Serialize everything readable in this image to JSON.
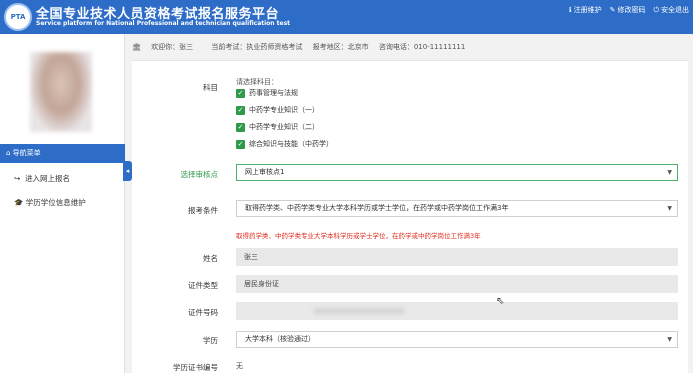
{
  "header": {
    "logo_text": "PTA",
    "title_cn": "全国专业技术人员资格考试报名服务平台",
    "title_en": "Service platform for National Professional and technician qualification test",
    "links": [
      {
        "icon": "info-icon",
        "glyph": "ℹ",
        "label": "注册维护"
      },
      {
        "icon": "edit-icon",
        "glyph": "✎",
        "label": "修改密码"
      },
      {
        "icon": "power-icon",
        "glyph": "⏻",
        "label": "安全退出"
      }
    ]
  },
  "infobar": {
    "welcome": "欢迎你：张三",
    "exam": "当前考试：执业药师资格考试",
    "region": "报考地区：北京市",
    "phone": "咨询电话：010-11111111"
  },
  "sidebar": {
    "nav_head": "导航菜单",
    "items": [
      {
        "label": "进入网上报名"
      },
      {
        "label": "学历学位信息维护"
      }
    ]
  },
  "form": {
    "subject_label": "科目",
    "subject_hint": "请选择科目：",
    "subjects": [
      "药事管理与法规",
      "中药学专业知识（一）",
      "中药学专业知识（二）",
      "综合知识与技能（中药学）"
    ],
    "review_label": "选择审核点",
    "review_value": "网上审核点1",
    "condition_label": "报考条件",
    "condition_value": "取得药学类、中药学类专业大学本科学历或学士学位，在药学或中药学岗位工作满3年",
    "condition_warning": "取得药学类、中药学类专业大学本科学历或学士学位，在药学或中药学岗位工作满3年",
    "name_label": "姓名",
    "name_value": "张三",
    "idtype_label": "证件类型",
    "idtype_value": "居民身份证",
    "idnum_label": "证件号码",
    "edu_label": "学历",
    "edu_value": "大学本科（核验通过）",
    "degree_label": "学历证书编号",
    "degree_value": "无"
  },
  "colors": {
    "brand": "#2d6cc7",
    "accent_green": "#2f9a4c",
    "warning": "#e0281b"
  }
}
